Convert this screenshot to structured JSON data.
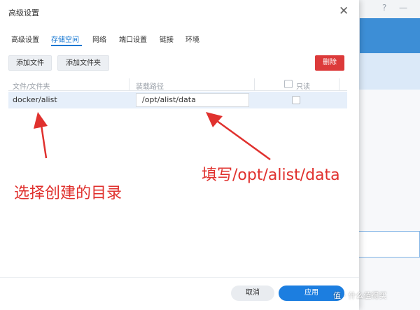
{
  "dialog": {
    "title": "高级设置",
    "close_symbol": "✕"
  },
  "tabs": [
    {
      "label": "高级设置"
    },
    {
      "label": "存储空间"
    },
    {
      "label": "网络"
    },
    {
      "label": "端口设置"
    },
    {
      "label": "链接"
    },
    {
      "label": "环境"
    }
  ],
  "active_tab": "存储空间",
  "toolbar": {
    "add_file": "添加文件",
    "add_folder": "添加文件夹",
    "delete": "删除"
  },
  "table": {
    "columns": [
      "文件/文件夹",
      "装载路径",
      "只读"
    ],
    "rows": [
      {
        "file_folder": "docker/alist",
        "mount_path": "/opt/alist/data",
        "read_only": false
      }
    ]
  },
  "annotations": {
    "left": "选择创建的目录",
    "right": "填写/opt/alist/data"
  },
  "footer": {
    "cancel": "取消",
    "apply": "应用"
  },
  "background_window": {
    "help_symbol": "?",
    "minimize_symbol": "—"
  },
  "watermark": "值 · 什么值得买",
  "colors": {
    "accent": "#1677d2",
    "danger": "#dc3a3a",
    "annotation": "#e0312e",
    "row_selected": "#e6effa"
  }
}
